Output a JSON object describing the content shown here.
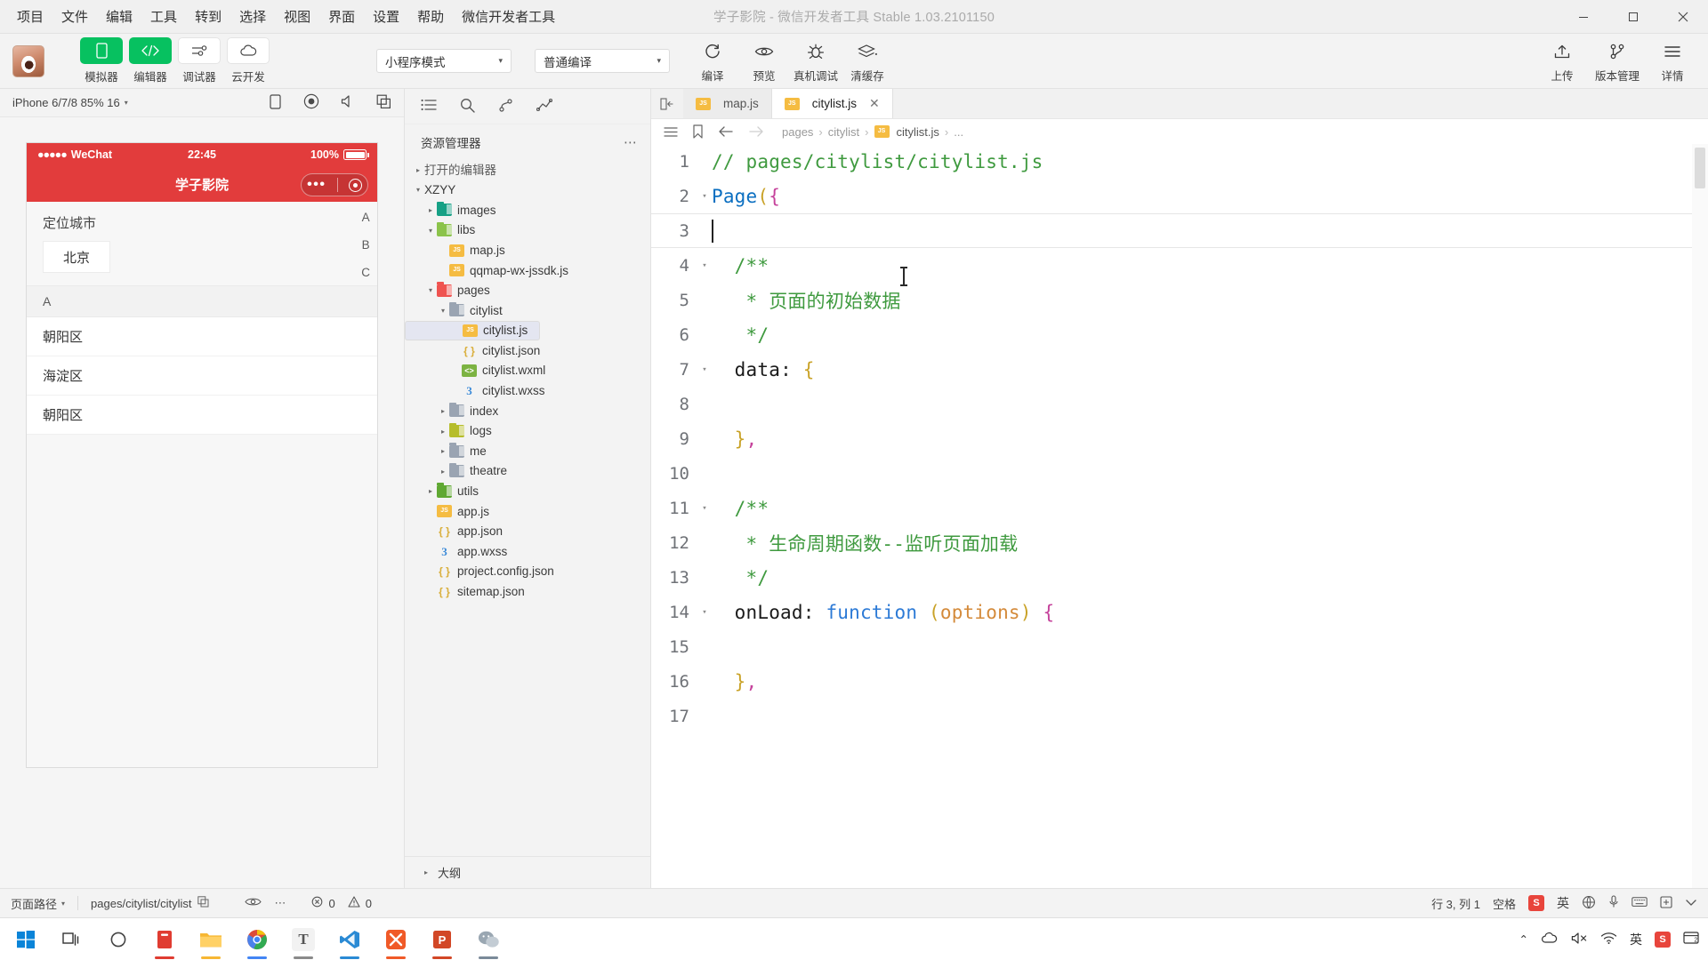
{
  "window": {
    "title": "学子影院 - 微信开发者工具 Stable 1.03.2101150",
    "menu": [
      "项目",
      "文件",
      "编辑",
      "工具",
      "转到",
      "选择",
      "视图",
      "界面",
      "设置",
      "帮助",
      "微信开发者工具"
    ],
    "controls": {
      "minimize": "–",
      "maximize": "□",
      "close": "✕"
    }
  },
  "toolbar": {
    "modes": [
      {
        "label": "模拟器",
        "icon": "phone-icon",
        "active": true
      },
      {
        "label": "编辑器",
        "icon": "code-icon",
        "active": true
      },
      {
        "label": "调试器",
        "icon": "sliders-icon",
        "active": false
      },
      {
        "label": "云开发",
        "icon": "cloud-icon",
        "active": false
      }
    ],
    "mode_select": {
      "value": "小程序模式",
      "caret": "▾"
    },
    "compile_select": {
      "value": "普通编译",
      "caret": "▾"
    },
    "actions": [
      {
        "label": "编译",
        "icon": "refresh-icon"
      },
      {
        "label": "预览",
        "icon": "eye-icon"
      },
      {
        "label": "真机调试",
        "icon": "bug-icon"
      },
      {
        "label": "清缓存",
        "icon": "layers-icon"
      }
    ],
    "right_actions": [
      {
        "label": "上传",
        "icon": "upload-icon"
      },
      {
        "label": "版本管理",
        "icon": "branch-icon"
      },
      {
        "label": "详情",
        "icon": "menu-icon"
      }
    ]
  },
  "simulator": {
    "device": "iPhone 6/7/8 85% 16",
    "caret": "▾",
    "icons": [
      "rotate-icon",
      "record-icon",
      "volume-icon",
      "copy-icon"
    ],
    "phone": {
      "status": {
        "dots": "●●●●●",
        "carrier": "WeChat",
        "wifi": "⌃",
        "time": "22:45",
        "battery": "100%"
      },
      "navbar_title": "学子影院",
      "capsule": {
        "dots": "•••",
        "target": "target-icon"
      },
      "section_title": "定位城市",
      "current_city": "北京",
      "index_letters": [
        "A",
        "B",
        "C"
      ],
      "groups": [
        {
          "letter": "A",
          "cities": [
            "朝阳区",
            "海淀区",
            "朝阳区"
          ]
        }
      ]
    }
  },
  "explorer": {
    "actions": [
      "list-icon",
      "search-icon",
      "source-control-icon",
      "graph-icon"
    ],
    "title": "资源管理器",
    "more": "⋯",
    "sections": [
      {
        "label": "打开的编辑器",
        "expanded": false
      },
      {
        "label": "XZYY",
        "expanded": true
      }
    ],
    "tree": [
      {
        "label": "images",
        "type": "folder",
        "color": "f-teal",
        "depth": 1,
        "twist": "▸"
      },
      {
        "label": "libs",
        "type": "folder",
        "color": "f-green",
        "depth": 1,
        "twist": "▾"
      },
      {
        "label": "map.js",
        "type": "js",
        "depth": 2,
        "twist": ""
      },
      {
        "label": "qqmap-wx-jssdk.js",
        "type": "js",
        "depth": 2,
        "twist": ""
      },
      {
        "label": "pages",
        "type": "folder",
        "color": "f-red",
        "depth": 1,
        "twist": "▾"
      },
      {
        "label": "citylist",
        "type": "folder",
        "color": "f-gray",
        "depth": 2,
        "twist": "▾"
      },
      {
        "label": "citylist.js",
        "type": "js",
        "depth": 3,
        "twist": "",
        "selected": true
      },
      {
        "label": "citylist.json",
        "type": "json",
        "depth": 3,
        "twist": ""
      },
      {
        "label": "citylist.wxml",
        "type": "wxml",
        "depth": 3,
        "twist": ""
      },
      {
        "label": "citylist.wxss",
        "type": "wxss",
        "depth": 3,
        "twist": ""
      },
      {
        "label": "index",
        "type": "folder",
        "color": "f-gray",
        "depth": 2,
        "twist": "▸"
      },
      {
        "label": "logs",
        "type": "folder",
        "color": "f-olive",
        "depth": 2,
        "twist": "▸"
      },
      {
        "label": "me",
        "type": "folder",
        "color": "f-gray",
        "depth": 2,
        "twist": "▸"
      },
      {
        "label": "theatre",
        "type": "folder",
        "color": "f-gray",
        "depth": 2,
        "twist": "▸"
      },
      {
        "label": "utils",
        "type": "folder",
        "color": "f-grass",
        "depth": 1,
        "twist": "▸"
      },
      {
        "label": "app.js",
        "type": "js",
        "depth": 1,
        "twist": ""
      },
      {
        "label": "app.json",
        "type": "json",
        "depth": 1,
        "twist": ""
      },
      {
        "label": "app.wxss",
        "type": "wxss",
        "depth": 1,
        "twist": ""
      },
      {
        "label": "project.config.json",
        "type": "json",
        "depth": 1,
        "twist": ""
      },
      {
        "label": "sitemap.json",
        "type": "json",
        "depth": 1,
        "twist": ""
      }
    ],
    "outline": {
      "label": "大纲",
      "twist": "▸"
    }
  },
  "editor": {
    "tabs": [
      {
        "label": "map.js",
        "icon": "js-icon",
        "active": false,
        "closable": false
      },
      {
        "label": "citylist.js",
        "icon": "js-icon",
        "active": true,
        "closable": true,
        "close": "✕"
      }
    ],
    "breadcrumb": {
      "items": [
        "pages",
        "citylist",
        "citylist.js",
        "..."
      ],
      "separator": "›"
    },
    "breadcrumb_icons": [
      "outline-icon",
      "bookmark-icon",
      "back-arrow-icon",
      "forward-arrow-icon"
    ],
    "lines": [
      {
        "n": "1",
        "fold": "",
        "tokens": [
          {
            "t": "// pages/citylist/citylist.js",
            "c": "cm"
          }
        ]
      },
      {
        "n": "2",
        "fold": "▾",
        "tokens": [
          {
            "t": "Page",
            "c": "kw"
          },
          {
            "t": "(",
            "c": "br1"
          },
          {
            "t": "{",
            "c": "br2"
          }
        ]
      },
      {
        "n": "3",
        "fold": "",
        "tokens": [],
        "cursor": true,
        "current": true
      },
      {
        "n": "4",
        "fold": "▾",
        "tokens": [
          {
            "t": "  /**",
            "c": "cm"
          }
        ]
      },
      {
        "n": "5",
        "fold": "",
        "tokens": [
          {
            "t": "   * ",
            "c": "cm"
          },
          {
            "t": "页面的初始数据",
            "c": "cm"
          }
        ]
      },
      {
        "n": "6",
        "fold": "",
        "tokens": [
          {
            "t": "   */",
            "c": "cm"
          }
        ]
      },
      {
        "n": "7",
        "fold": "▾",
        "tokens": [
          {
            "t": "  data",
            "c": "id"
          },
          {
            "t": ": ",
            "c": "pl"
          },
          {
            "t": "{",
            "c": "br1"
          }
        ]
      },
      {
        "n": "8",
        "fold": "",
        "tokens": []
      },
      {
        "n": "9",
        "fold": "",
        "tokens": [
          {
            "t": "  }",
            "c": "br1"
          },
          {
            "t": ",",
            "c": "br2"
          }
        ]
      },
      {
        "n": "10",
        "fold": "",
        "tokens": []
      },
      {
        "n": "11",
        "fold": "▾",
        "tokens": [
          {
            "t": "  /**",
            "c": "cm"
          }
        ]
      },
      {
        "n": "12",
        "fold": "",
        "tokens": [
          {
            "t": "   * ",
            "c": "cm"
          },
          {
            "t": "生命周期函数--监听页面加载",
            "c": "cm"
          }
        ]
      },
      {
        "n": "13",
        "fold": "",
        "tokens": [
          {
            "t": "   */",
            "c": "cm"
          }
        ]
      },
      {
        "n": "14",
        "fold": "▾",
        "tokens": [
          {
            "t": "  onLoad",
            "c": "id"
          },
          {
            "t": ": ",
            "c": "pl"
          },
          {
            "t": "function",
            "c": "kw2"
          },
          {
            "t": " (",
            "c": "br1"
          },
          {
            "t": "options",
            "c": "par"
          },
          {
            "t": ") ",
            "c": "br1"
          },
          {
            "t": "{",
            "c": "br2"
          }
        ]
      },
      {
        "n": "15",
        "fold": "",
        "tokens": []
      },
      {
        "n": "16",
        "fold": "",
        "tokens": [
          {
            "t": "  }",
            "c": "br1"
          },
          {
            "t": ",",
            "c": "br2"
          }
        ]
      },
      {
        "n": "17",
        "fold": "",
        "tokens": []
      }
    ]
  },
  "status_bar": {
    "page_path_label": "页面路径",
    "page_path_caret": "▾",
    "current_path": "pages/citylist/citylist",
    "copy_icon": "copy-icon",
    "preview_icon": "eye-icon",
    "more": "⋯",
    "errors": {
      "icon": "error-icon",
      "count": "0"
    },
    "warnings": {
      "icon": "warning-icon",
      "count": "0"
    },
    "cursor_position": "行 3, 列 1",
    "spaces": "空格",
    "ime_badge": "S",
    "ime_label": "英"
  },
  "taskbar": {
    "items": [
      {
        "name": "start-button",
        "icon": "windows-icon",
        "color": "#0078d7"
      },
      {
        "name": "task-view-button",
        "icon": "task-view-icon",
        "color": "#333333"
      },
      {
        "name": "cortana-button",
        "icon": "circle-icon",
        "color": "#555555"
      },
      {
        "name": "app-clipboard",
        "icon": "clipboard-icon",
        "color": "#e03c31",
        "label": ""
      },
      {
        "name": "app-explorer",
        "icon": "folder-icon",
        "color": "#f6b93b",
        "label": ""
      },
      {
        "name": "app-chrome",
        "icon": "chrome-icon",
        "color": "#4285f4",
        "label": ""
      },
      {
        "name": "app-typora",
        "icon": "typora-icon",
        "color": "#666666",
        "label": "T"
      },
      {
        "name": "app-vscode",
        "icon": "vscode-icon",
        "color": "#1f6fb5",
        "label": ""
      },
      {
        "name": "app-xmind",
        "icon": "xmind-icon",
        "color": "#e8653a",
        "label": ""
      },
      {
        "name": "app-powerpoint",
        "icon": "powerpoint-icon",
        "color": "#d24726",
        "label": "P"
      },
      {
        "name": "app-devtools",
        "icon": "wechat-devtools-icon",
        "color": "#7a8a99",
        "label": ""
      }
    ],
    "tray": {
      "chevron": "⌃",
      "icons": [
        "cloud-icon",
        "mute-icon",
        "wifi-icon"
      ],
      "ime": "英",
      "sogou": "S",
      "notification": "notification-icon"
    },
    "clock": {
      "time": "",
      "date": ""
    }
  },
  "colors": {
    "accent_green": "#07c160",
    "phone_red": "#e23c3c",
    "selection_blue": "#e4e6f1",
    "comment_green": "#3f9a3f"
  }
}
